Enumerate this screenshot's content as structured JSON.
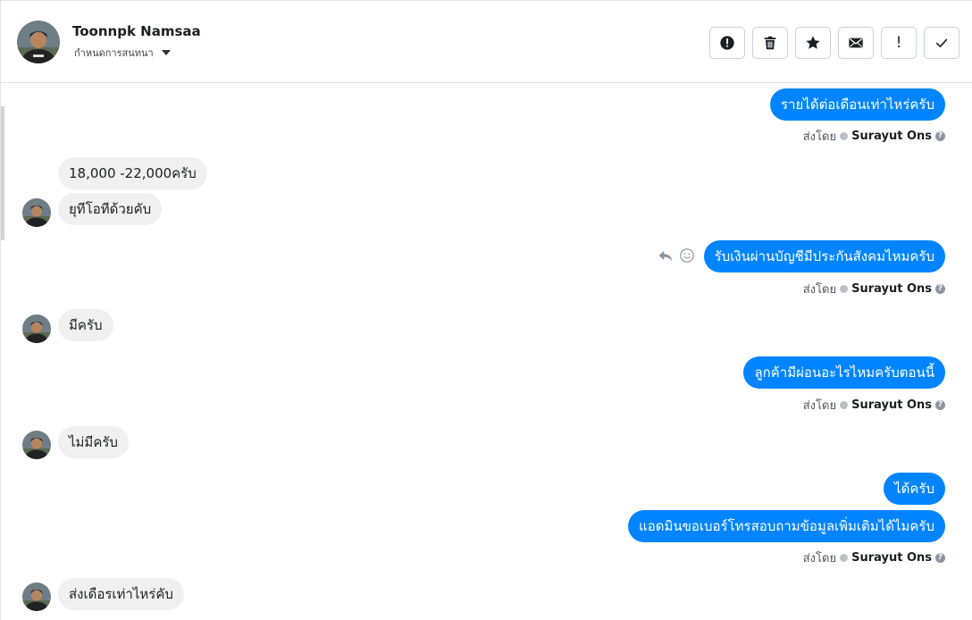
{
  "header": {
    "contact_name": "Toonnpk Namsaa",
    "label_selector": "กำหนดการสนทนา",
    "actions": [
      {
        "icon": "alert-circle-icon",
        "name": "spam-button"
      },
      {
        "icon": "trash-icon",
        "name": "delete-button"
      },
      {
        "icon": "star-icon",
        "name": "star-button"
      },
      {
        "icon": "envelope-icon",
        "name": "mark-unread-button"
      },
      {
        "icon": "exclamation-icon",
        "name": "follow-up-button",
        "glyph": "!"
      },
      {
        "icon": "checkmark-icon",
        "name": "mark-done-button"
      }
    ]
  },
  "messages": {
    "m1": "รายได้ต่อเดือนเท่าไหร่ครับ",
    "m2": "18,000 -22,000ครับ",
    "m3": "ยุทีโอทีด้วยคับ",
    "m4": "รับเงินผ่านบัญชีมีประกันสังคมไหมครับ",
    "m5": "มีครับ",
    "m6": "ลูกค้ามีผ่อนอะไรไหมครับตอนนี้",
    "m7": "ไม่มีครับ",
    "m8": "ได้ครับ",
    "m9": "แอดมินขอเบอร์โทรสอบถามข้อมูลเพิ่มเติมได้ไมครับ",
    "m10": "ส่งเดือรเท่าไหร่คับ"
  },
  "sent_by": {
    "prefix": "ส่งโดย",
    "agent": "Surayut Ons",
    "help_glyph": "?"
  },
  "hover_tools": [
    "reply-icon",
    "emoji-icon"
  ],
  "colors": {
    "outgoing_bubble": "#0084ff",
    "incoming_bubble": "#f0f0f0",
    "border": "#dddfe2"
  }
}
